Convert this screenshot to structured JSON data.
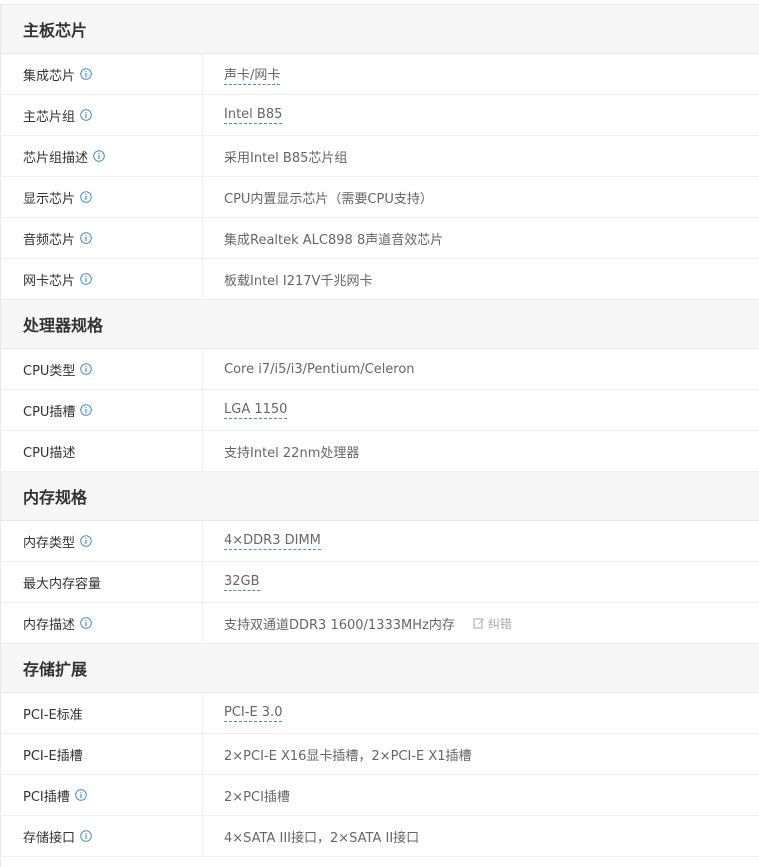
{
  "sections": [
    {
      "title": "主板芯片",
      "rows": [
        {
          "label": "集成芯片",
          "info": true,
          "value": "声卡/网卡",
          "link": true
        },
        {
          "label": "主芯片组",
          "info": true,
          "value": "Intel B85",
          "link": true
        },
        {
          "label": "芯片组描述",
          "info": true,
          "value": "采用Intel B85芯片组",
          "link": false
        },
        {
          "label": "显示芯片",
          "info": true,
          "value": "CPU内置显示芯片（需要CPU支持）",
          "link": false
        },
        {
          "label": "音频芯片",
          "info": true,
          "value": "集成Realtek ALC898 8声道音效芯片",
          "link": false
        },
        {
          "label": "网卡芯片",
          "info": true,
          "value": "板载Intel I217V千兆网卡",
          "link": false
        }
      ]
    },
    {
      "title": "处理器规格",
      "rows": [
        {
          "label": "CPU类型",
          "info": true,
          "value": "Core i7/i5/i3/Pentium/Celeron",
          "link": false
        },
        {
          "label": "CPU插槽",
          "info": true,
          "value": "LGA 1150",
          "link": true
        },
        {
          "label": "CPU描述",
          "info": false,
          "value": "支持Intel 22nm处理器",
          "link": false
        }
      ]
    },
    {
      "title": "内存规格",
      "rows": [
        {
          "label": "内存类型",
          "info": true,
          "value": "4×DDR3 DIMM",
          "link": true
        },
        {
          "label": "最大内存容量",
          "info": false,
          "value": "32GB",
          "link": true
        },
        {
          "label": "内存描述",
          "info": true,
          "value": "支持双通道DDR3 1600/1333MHz内存",
          "link": false,
          "correct": "纠错"
        }
      ]
    },
    {
      "title": "存储扩展",
      "rows": [
        {
          "label": "PCI-E标准",
          "info": false,
          "value": "PCI-E 3.0",
          "link": true
        },
        {
          "label": "PCI-E插槽",
          "info": false,
          "value": "2×PCI-E X16显卡插槽，2×PCI-E X1插槽",
          "link": false
        },
        {
          "label": "PCI插槽",
          "info": true,
          "value": "2×PCI插槽",
          "link": false
        },
        {
          "label": "存储接口",
          "info": true,
          "value": "4×SATA III接口，2×SATA II接口",
          "link": false
        }
      ]
    }
  ],
  "colors": {
    "info_icon": "#4a90c8",
    "header_bg": "#f7f7f7",
    "link_underline": "#4a90c8"
  }
}
